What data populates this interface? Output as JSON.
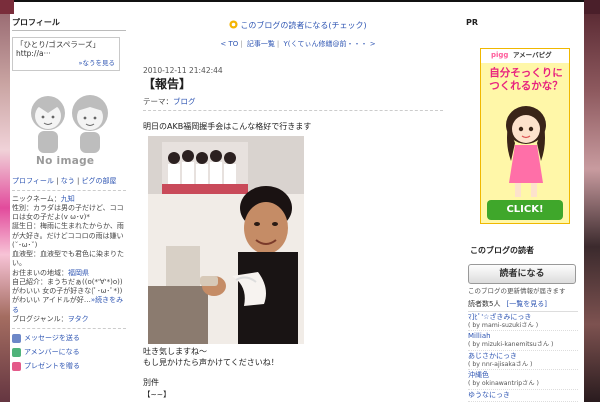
{
  "colors": {
    "link": "#2f56b3",
    "accent_pink": "#e8237f",
    "button_green": "#3fa72b"
  },
  "left": {
    "heading": "プロフィール",
    "profile_title": "「ひとり/ゴスペラーズ」 http://a···",
    "more_link": "»なうを見る",
    "no_image": "No image",
    "links": [
      "プロフィール",
      "なう",
      "ピグの部屋"
    ],
    "info": [
      {
        "label": "ニックネーム：",
        "value": "九知"
      },
      {
        "label": "性別：",
        "value": "カラダは男の子だけど、ココロは女の子だよ(v ω･v)*"
      },
      {
        "label": "誕生日：",
        "value": "梅雨に生まれたからか、雨が大好き。だけどココロの雨は嫌い(˘･ω･˘)"
      },
      {
        "label": "血液型：",
        "value": "血液型でも君色に染まりたい。"
      },
      {
        "label": "お住まいの地域：",
        "value": "福岡県"
      },
      {
        "label": "自己紹介：",
        "value": "まうちだぁ((o(*'∀'*)o))がわいい 女の子が好きな(ﾟ･ω･ﾟ*))がわいい アイドルが好…"
      },
      {
        "label": "",
        "value": "»続きをみる"
      },
      {
        "label": "ブログジャンル：",
        "value": "ヲタク"
      }
    ],
    "actions": [
      "メッセージを送る",
      "アメンバーになる",
      "プレゼントを贈る"
    ]
  },
  "center": {
    "follow": "このブログの読者になる(チェック)",
    "nav": [
      "< TO",
      "記事一覧",
      "Y(ㄑてぃん修繕@前・・・ >"
    ],
    "date": "2010-12-11 21:42:44",
    "title": "【報告】",
    "theme_label": "テーマ：",
    "theme_value": "ブログ",
    "p1": "明日のAKB福岡握手会はこんな格好で行きます",
    "p2a": "吐き気しますね〜",
    "p2b": "もし見かけたら声かけてくださいね！",
    "p3": "別件",
    "p4": "【~~】"
  },
  "right": {
    "pr": "PR",
    "ad": {
      "brand1": "pigg",
      "brand2": "アメーバピグ",
      "headline": "自分そっくりにつくれるかな？",
      "cta": "CLICK!"
    },
    "readers_title": "このブログの読者",
    "read_button": "読者になる",
    "update_note": "このブログの更新情報が届きます",
    "count_label": "読者数5人",
    "list_link": "[一覧を見る]",
    "readers": [
      {
        "name": "ﾏ]ﾋﾟ'☆ざきみにっき",
        "by": "( by mami-suzukiさん )"
      },
      {
        "name": "Milliah",
        "by": "( by mizuki-kanemitsuさん )"
      },
      {
        "name": "あじさかにっき",
        "by": "( by nnr-ajisakaさん )"
      },
      {
        "name": "沖縄色",
        "by": "( by okinawantripさん )"
      },
      {
        "name": "ゆうなにっき",
        "by": ""
      }
    ]
  }
}
